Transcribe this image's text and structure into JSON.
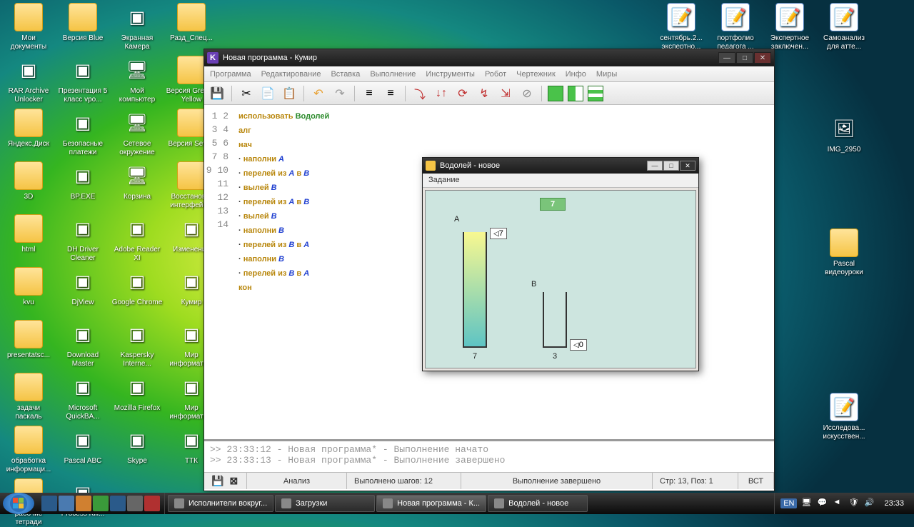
{
  "desktop": {
    "icons_left": [
      {
        "lbl": "Мои документы",
        "t": "folder"
      },
      {
        "lbl": "Версия Blue",
        "t": "folder"
      },
      {
        "lbl": "Экранная Камера",
        "t": "app"
      },
      {
        "lbl": "Разд_Спец...",
        "t": "folder"
      },
      {
        "lbl": "RAR Archive Unlocker",
        "t": "app"
      },
      {
        "lbl": "Презентация 5 класс vpo...",
        "t": "app"
      },
      {
        "lbl": "Мой компьютер",
        "t": "sys"
      },
      {
        "lbl": "Версия Green - Yellow",
        "t": "folder"
      },
      {
        "lbl": "Яндекс.Диск",
        "t": "folder"
      },
      {
        "lbl": "Безопасные платежи",
        "t": "app"
      },
      {
        "lbl": "Сетевое окружение",
        "t": "sys"
      },
      {
        "lbl": "Версия Seven",
        "t": "folder"
      },
      {
        "lbl": "3D",
        "t": "folder"
      },
      {
        "lbl": "BP.EXE",
        "t": "app"
      },
      {
        "lbl": "Корзина",
        "t": "sys"
      },
      {
        "lbl": "Восстановл. интерфейс...",
        "t": "folder"
      },
      {
        "lbl": "html",
        "t": "folder"
      },
      {
        "lbl": "DH Driver Cleaner",
        "t": "app"
      },
      {
        "lbl": "Adobe Reader XI",
        "t": "app"
      },
      {
        "lbl": "Изменение",
        "t": "app"
      },
      {
        "lbl": "kvu",
        "t": "folder"
      },
      {
        "lbl": "DjView",
        "t": "app"
      },
      {
        "lbl": "Google Chrome",
        "t": "app"
      },
      {
        "lbl": "Кумир",
        "t": "app"
      },
      {
        "lbl": "presentatsc...",
        "t": "folder"
      },
      {
        "lbl": "Download Master",
        "t": "app"
      },
      {
        "lbl": "Kaspersky Interne...",
        "t": "app"
      },
      {
        "lbl": "Мир информати...",
        "t": "app"
      },
      {
        "lbl": "задачи паскаль",
        "t": "folder"
      },
      {
        "lbl": "Microsoft QuickBA...",
        "t": "app"
      },
      {
        "lbl": "Mozilla Firefox",
        "t": "app"
      },
      {
        "lbl": "Мир информати...",
        "t": "app"
      },
      {
        "lbl": "обработка информаци...",
        "t": "folder"
      },
      {
        "lbl": "Pascal ABC",
        "t": "app"
      },
      {
        "lbl": "Skype",
        "t": "app"
      },
      {
        "lbl": "ТТК",
        "t": "app"
      },
      {
        "lbl": "рабочие тетради",
        "t": "folder"
      },
      {
        "lbl": "Process Kill...",
        "t": "app"
      }
    ],
    "icons_right": [
      {
        "lbl": "сентябрь.2... экспертно...",
        "t": "doc"
      },
      {
        "lbl": "портфолио педагога ...",
        "t": "doc"
      },
      {
        "lbl": "Экспертное заключен...",
        "t": "doc"
      },
      {
        "lbl": "Самоанализ для атте...",
        "t": "doc"
      },
      {
        "lbl": "IMG_2950",
        "t": "img"
      },
      {
        "lbl": "Pascal видеоуроки",
        "t": "folder"
      },
      {
        "lbl": "Исследова... искусствен...",
        "t": "doc"
      }
    ]
  },
  "kumir": {
    "title": "Новая программа - Кумир",
    "menu": [
      "Программа",
      "Редактирование",
      "Вставка",
      "Выполнение",
      "Инструменты",
      "Робот",
      "Чертежник",
      "Инфо",
      "Миры"
    ],
    "lines": [
      {
        "n": 1,
        "pre": "",
        "t": [
          [
            "использовать ",
            "kw"
          ],
          [
            "Водолей",
            "mod"
          ]
        ]
      },
      {
        "n": 2,
        "pre": "",
        "t": [
          [
            "алг",
            "kw"
          ]
        ]
      },
      {
        "n": 3,
        "pre": "",
        "t": [
          [
            "нач",
            "kw"
          ]
        ]
      },
      {
        "n": 4,
        "pre": "· ",
        "t": [
          [
            "наполни ",
            "kw"
          ],
          [
            "A",
            "id"
          ]
        ]
      },
      {
        "n": 5,
        "pre": "· ",
        "t": [
          [
            "перелей из ",
            "kw"
          ],
          [
            "A",
            "id"
          ],
          [
            " в ",
            "kw"
          ],
          [
            "B",
            "id"
          ]
        ]
      },
      {
        "n": 6,
        "pre": "· ",
        "t": [
          [
            "вылей ",
            "kw"
          ],
          [
            "B",
            "id"
          ]
        ]
      },
      {
        "n": 7,
        "pre": "· ",
        "t": [
          [
            "перелей из ",
            "kw"
          ],
          [
            "A",
            "id"
          ],
          [
            " в ",
            "kw"
          ],
          [
            "B",
            "id"
          ]
        ]
      },
      {
        "n": 8,
        "pre": "· ",
        "t": [
          [
            "вылей ",
            "kw"
          ],
          [
            "B",
            "id"
          ]
        ]
      },
      {
        "n": 9,
        "pre": "· ",
        "t": [
          [
            "наполни ",
            "kw"
          ],
          [
            "B",
            "id"
          ]
        ]
      },
      {
        "n": 10,
        "pre": "· ",
        "t": [
          [
            "перелей из ",
            "kw"
          ],
          [
            "B",
            "id"
          ],
          [
            " в ",
            "kw"
          ],
          [
            "A",
            "id"
          ]
        ]
      },
      {
        "n": 11,
        "pre": "· ",
        "t": [
          [
            "наполни ",
            "kw"
          ],
          [
            "B",
            "id"
          ]
        ]
      },
      {
        "n": 12,
        "pre": "· ",
        "t": [
          [
            "перелей из ",
            "kw"
          ],
          [
            "B",
            "id"
          ],
          [
            " в ",
            "kw"
          ],
          [
            "A",
            "id"
          ]
        ]
      },
      {
        "n": 13,
        "pre": "",
        "t": [
          [
            "кон",
            "kw"
          ]
        ]
      },
      {
        "n": 14,
        "pre": "",
        "t": []
      }
    ],
    "output": [
      ">> 23:33:12 - Новая программа* - Выполнение начато",
      ">> 23:33:13 - Новая программа* - Выполнение завершено"
    ],
    "status": {
      "analysis": "Анализ",
      "steps": "Выполнено шагов: 12",
      "state": "Выполнение завершено",
      "pos": "Стр: 13, Поз: 1",
      "mode": "ВСТ"
    }
  },
  "vodolej": {
    "title": "Водолей - новое",
    "menu": "Задание",
    "target": "7",
    "A": {
      "label": "A",
      "cap": "7",
      "level": "7"
    },
    "B": {
      "label": "B",
      "cap": "3",
      "level": "0"
    }
  },
  "chart_data": {
    "type": "bar",
    "title": "Водолей",
    "categories": [
      "A",
      "B"
    ],
    "capacities": [
      7,
      3
    ],
    "values": [
      7,
      0
    ],
    "target": 7,
    "ylim": [
      0,
      7
    ]
  },
  "taskbar": {
    "items": [
      {
        "lbl": "Исполнители вокруг..."
      },
      {
        "lbl": "Загрузки"
      },
      {
        "lbl": "Новая программа - К..."
      },
      {
        "lbl": "Водолей - новое"
      }
    ],
    "lang": "EN",
    "clock": "23:33"
  }
}
